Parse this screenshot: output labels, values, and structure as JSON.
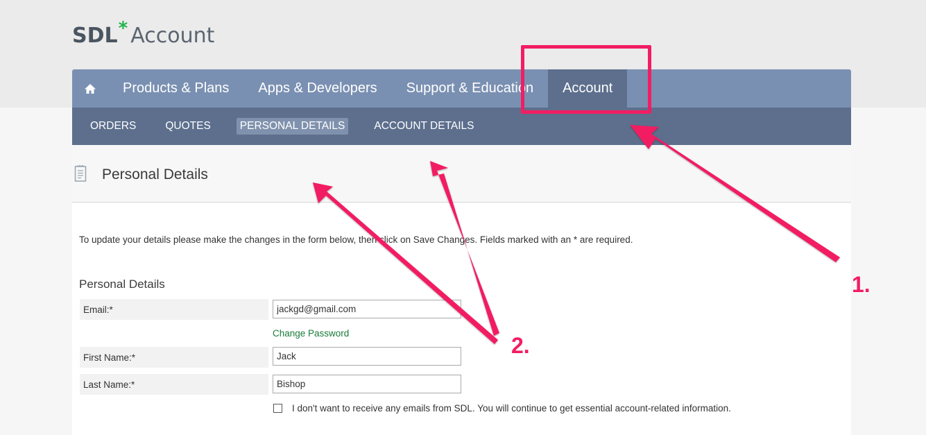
{
  "brand": {
    "name": "SDL",
    "star": "*",
    "product": "Account"
  },
  "colors": {
    "accent": "#f21d63",
    "nav": "#7a90b2",
    "nav_active": "#5d6f8d",
    "link": "#1a7a3a",
    "brand_star": "#21b44b"
  },
  "main_nav": {
    "home_icon": "home-icon",
    "items": [
      {
        "label": "Products & Plans"
      },
      {
        "label": "Apps & Developers"
      },
      {
        "label": "Support & Education"
      },
      {
        "label": "Account",
        "active": true
      }
    ]
  },
  "sub_nav": {
    "items": [
      {
        "label": "ORDERS"
      },
      {
        "label": "QUOTES"
      },
      {
        "label": "PERSONAL DETAILS",
        "active": true
      },
      {
        "label": "ACCOUNT DETAILS"
      }
    ]
  },
  "page": {
    "icon": "document-icon",
    "title": "Personal Details",
    "intro": "To update your details please make the changes in the form below, then click on Save Changes. Fields marked with an * are required.",
    "section_title": "Personal Details"
  },
  "form": {
    "email": {
      "label": "Email:*",
      "value": "jackgd@gmail.com"
    },
    "change_password": "Change Password",
    "first_name": {
      "label": "First Name:*",
      "value": "Jack"
    },
    "last_name": {
      "label": "Last Name:*",
      "value": "Bishop"
    },
    "opt_out": {
      "label": "I don't want to receive any emails from SDL. You will continue to get essential account-related information.",
      "checked": false
    }
  },
  "annotations": {
    "callout_1": "1.",
    "callout_2": "2."
  }
}
